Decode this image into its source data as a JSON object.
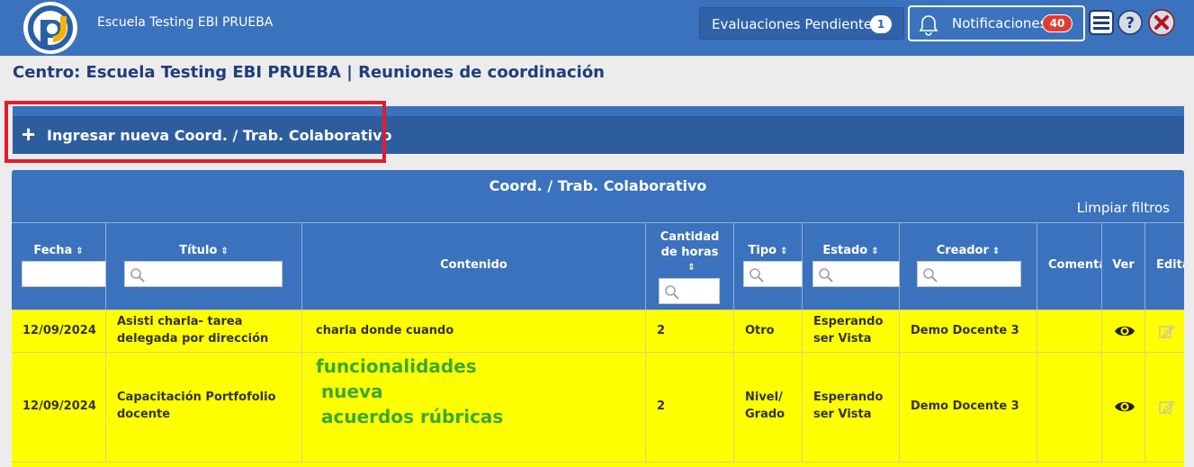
{
  "header": {
    "school_name": "Escuela Testing EBI PRUEBA",
    "pending_label": "Evaluaciones Pendientes",
    "pending_count": "1",
    "notifications_label": "Notificaciones",
    "notifications_count": "40",
    "accent_color": "#3b72bd"
  },
  "page": {
    "title": "Centro: Escuela Testing EBI PRUEBA | Reuniones de coordinación",
    "new_entry_label": "Ingresar nueva Coord. / Trab. Colaborativo"
  },
  "table": {
    "title": "Coord. / Trab. Colaborativo",
    "clear_filters": "Limpiar filtros",
    "columns": {
      "fecha": "Fecha",
      "titulo": "Título",
      "contenido": "Contenido",
      "horas_1": "Cantidad",
      "horas_2": "de horas",
      "tipo": "Tipo",
      "estado": "Estado",
      "creador": "Creador",
      "comentarios": "Comenta",
      "ver": "Ver",
      "editar": "Edita"
    },
    "rows": [
      {
        "fecha": "12/09/2024",
        "titulo_1": "Asisti charla- tarea",
        "titulo_2": "delegada por dirección",
        "contenido": "charla donde cuando",
        "horas": "2",
        "tipo": "Otro",
        "estado_1": "Esperando",
        "estado_2": "ser Vista",
        "creador": "Demo Docente 3"
      },
      {
        "fecha": "12/09/2024",
        "titulo_1": "Capacitación Portfofolio",
        "titulo_2": "docente",
        "contenido_1": "funcionalidades",
        "contenido_2": "nueva",
        "contenido_3": "acuerdos rúbricas",
        "horas": "2",
        "tipo_1": "Nivel/",
        "tipo_2": "Grado",
        "estado_1": "Esperando",
        "estado_2": "ser Vista",
        "creador": "Demo Docente 3"
      }
    ],
    "row_color": "#ffff00"
  },
  "icons": [
    "logo",
    "bell-icon",
    "list-icon",
    "help-icon",
    "close-icon",
    "search-icon",
    "eye-icon",
    "edit-icon",
    "plus-icon",
    "sort-icon"
  ]
}
